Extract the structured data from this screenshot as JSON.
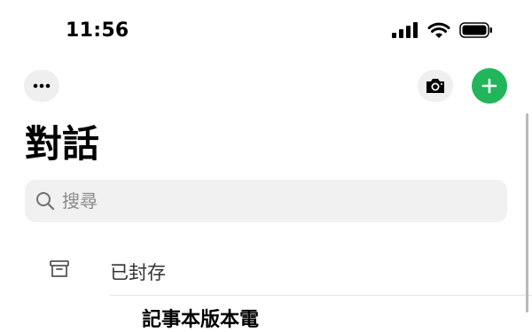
{
  "status_bar": {
    "time": "11:56"
  },
  "header": {
    "menu_icon": "ellipsis-icon",
    "camera_icon": "camera-icon",
    "new_chat_icon": "plus-icon",
    "accent_color": "#22b55b"
  },
  "page": {
    "title": "對話"
  },
  "search": {
    "placeholder": "搜尋"
  },
  "archived": {
    "label": "已封存"
  },
  "next_row": {
    "title": "記事本版本電"
  }
}
